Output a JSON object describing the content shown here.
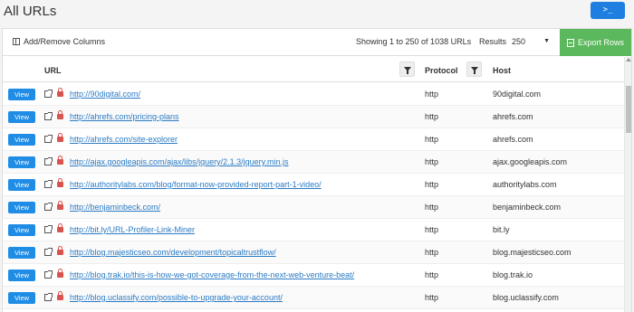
{
  "page": {
    "title": "All URLs"
  },
  "terminal_button": {
    "label": ">_"
  },
  "toolbar": {
    "add_remove_columns": "Add/Remove Columns",
    "showing": "Showing 1 to 250 of 1038 URLs",
    "results_label": "Results",
    "results_value": "250",
    "export_label": "Export Rows"
  },
  "columns": {
    "url": "URL",
    "protocol": "Protocol",
    "host": "Host"
  },
  "view_label": "View",
  "rows": [
    {
      "url": "http://90digital.com/",
      "protocol": "http",
      "host": "90digital.com"
    },
    {
      "url": "http://ahrefs.com/pricing-plans",
      "protocol": "http",
      "host": "ahrefs.com"
    },
    {
      "url": "http://ahrefs.com/site-explorer",
      "protocol": "http",
      "host": "ahrefs.com"
    },
    {
      "url": "http://ajax.googleapis.com/ajax/libs/jquery/2.1.3/jquery.min.js",
      "protocol": "http",
      "host": "ajax.googleapis.com"
    },
    {
      "url": "http://authoritylabs.com/blog/format-now-provided-report-part-1-video/",
      "protocol": "http",
      "host": "authoritylabs.com"
    },
    {
      "url": "http://benjaminbeck.com/",
      "protocol": "http",
      "host": "benjaminbeck.com"
    },
    {
      "url": "http://bit.ly/URL-Profiler-Link-Miner",
      "protocol": "http",
      "host": "bit.ly"
    },
    {
      "url": "http://blog.majesticseo.com/development/topicaltrustflow/",
      "protocol": "http",
      "host": "blog.majesticseo.com"
    },
    {
      "url": "http://blog.trak.io/this-is-how-we-got-coverage-from-the-next-web-venture-beat/",
      "protocol": "http",
      "host": "blog.trak.io"
    },
    {
      "url": "http://blog.uclassify.com/possible-to-upgrade-your-account/",
      "protocol": "http",
      "host": "blog.uclassify.com"
    }
  ]
}
